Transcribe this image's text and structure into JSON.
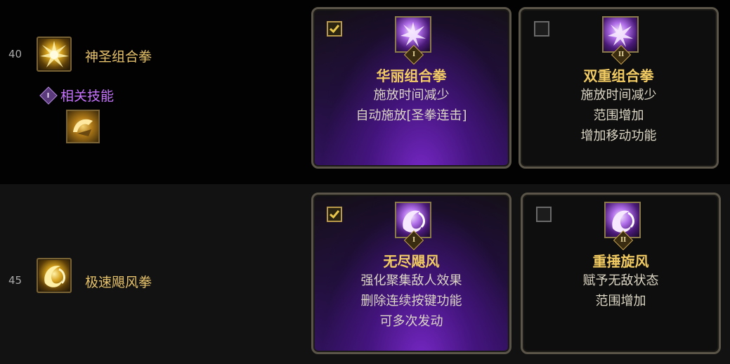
{
  "rows": [
    {
      "level": "40",
      "skill_name": "神圣组合拳",
      "skill_icon": "golden-burst-icon",
      "related": {
        "badge": "I",
        "label": "相关技能",
        "icon": "golden-fist-icon"
      },
      "options": [
        {
          "checked": true,
          "badge": "I",
          "icon": "purple-burst-icon",
          "title": "华丽组合拳",
          "lines": [
            "施放时间减少",
            "自动施放[圣拳连击]"
          ]
        },
        {
          "checked": false,
          "badge": "II",
          "icon": "purple-burst-icon",
          "title": "双重组合拳",
          "lines": [
            "施放时间减少",
            "范围增加",
            "增加移动功能"
          ]
        }
      ]
    },
    {
      "level": "45",
      "skill_name": "极速飓风拳",
      "skill_icon": "golden-whirl-icon",
      "options": [
        {
          "checked": true,
          "badge": "I",
          "icon": "purple-whirl-icon",
          "title": "无尽飓风",
          "lines": [
            "强化聚集敌人效果",
            "删除连续按键功能",
            "可多次发动"
          ]
        },
        {
          "checked": false,
          "badge": "II",
          "icon": "purple-whirl-icon",
          "title": "重捶旋风",
          "lines": [
            "赋予无敌状态",
            "范围增加"
          ]
        }
      ]
    }
  ],
  "colors": {
    "gold_text": "#e6c26a",
    "purple_text": "#c873ff",
    "title_gold": "#f2cc62",
    "selected_glow": "#7828c8"
  }
}
